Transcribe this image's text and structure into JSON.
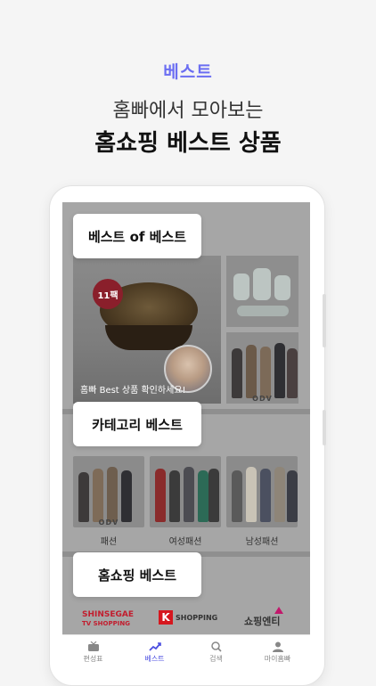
{
  "hero": {
    "tag": "베스트",
    "subtitle": "홈빠에서 모아보는",
    "title": "홈쇼핑 베스트 상품"
  },
  "sections": {
    "best_of_best": "베스트 of 베스트",
    "category_best": "카테고리 베스트",
    "homeshopping_best": "홈쇼핑 베스트"
  },
  "featured": {
    "badge": "11팩",
    "caption": "홈빠 Best 상품 확인하세요!",
    "thumb_brand_a": "ODV",
    "thumb_brand_b": "ODV"
  },
  "categories": [
    {
      "label": "패션",
      "brand": "ODV"
    },
    {
      "label": "여성패션",
      "brand": ""
    },
    {
      "label": "남성패션",
      "brand": ""
    }
  ],
  "logos": {
    "shinsegae_1": "SHINSEGAE",
    "shinsegae_2": "TV SHOPPING",
    "k_mark": "K",
    "k_text": "SHOPPING",
    "shopping_n": "쇼핑엔티"
  },
  "tabbar": {
    "items": [
      {
        "label": "편성표",
        "icon": "tv-icon"
      },
      {
        "label": "베스트",
        "icon": "trending-icon"
      },
      {
        "label": "검색",
        "icon": "search-icon"
      },
      {
        "label": "마이홈빠",
        "icon": "user-icon"
      }
    ],
    "active_index": 1
  },
  "colors": {
    "accent": "#6b6ef2",
    "tab_active": "#4b4ee0",
    "badge": "#8a1f2b",
    "shinsegae": "#c21d2e",
    "k_shopping": "#d6171e",
    "shopping_n": "#c2186b"
  }
}
